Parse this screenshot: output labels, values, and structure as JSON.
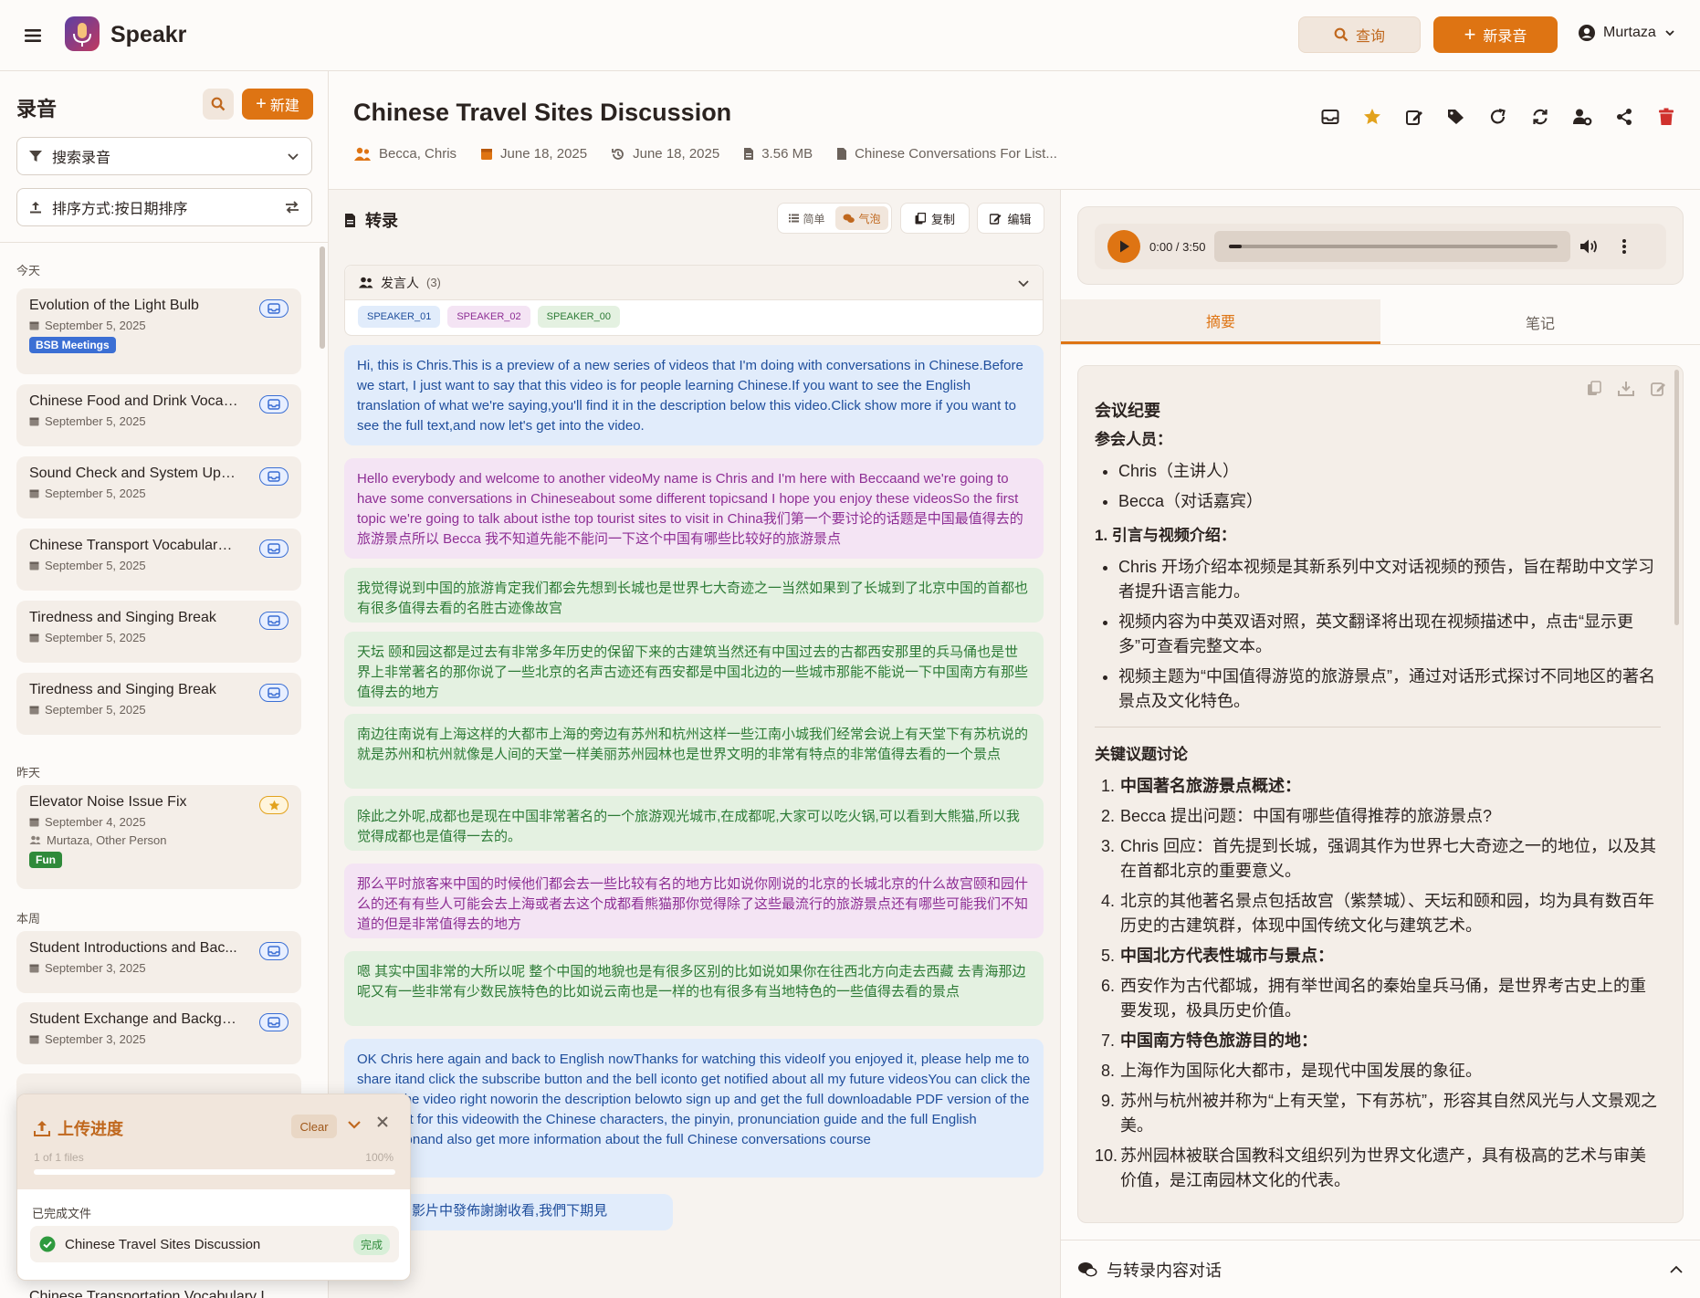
{
  "header": {
    "app_name": "Speakr",
    "query_label": "查询",
    "new_recording_label": "新录音",
    "user_name": "Murtaza"
  },
  "sidebar": {
    "title": "录音",
    "new_label": "新建",
    "search_placeholder": "搜索录音",
    "sort_label": "排序方式:按日期排序",
    "groups": [
      {
        "label": "今天"
      },
      {
        "label": "昨天"
      },
      {
        "label": "本周"
      }
    ],
    "recordings": [
      {
        "title": "Evolution of the Light Bulb",
        "date": "September 5, 2025",
        "tag": "BSB Meetings"
      },
      {
        "title": "Chinese Food and Drink Vocab...",
        "date": "September 5, 2025"
      },
      {
        "title": "Sound Check and System Upd...",
        "date": "September 5, 2025"
      },
      {
        "title": "Chinese Transport Vocabulary ...",
        "date": "September 5, 2025"
      },
      {
        "title": "Tiredness and Singing Break",
        "date": "September 5, 2025"
      },
      {
        "title": "Tiredness and Singing Break",
        "date": "September 5, 2025"
      },
      {
        "title": "Elevator Noise Issue Fix",
        "date": "September 4, 2025",
        "participants": "Murtaza, Other Person",
        "tag": "Fun"
      },
      {
        "title": "Student Introductions and Bac...",
        "date": "September 3, 2025"
      },
      {
        "title": "Student Exchange and Backgro...",
        "date": "September 3, 2025"
      },
      {
        "title": "Chinese Transportation Vocabulary L..."
      }
    ]
  },
  "upload": {
    "title": "上传进度",
    "clear_label": "Clear",
    "count": "1 of 1 files",
    "percent": "100%",
    "progress": 1.0,
    "done_label": "已完成文件",
    "file_name": "Chinese Travel Sites Discussion",
    "file_status": "完成"
  },
  "recording": {
    "title": "Chinese Travel Sites Discussion",
    "participants": "Becca, Chris",
    "date": "June 18, 2025",
    "date2": "June 18, 2025",
    "size": "3.56 MB",
    "folder": "Chinese Conversations For List..."
  },
  "transcript": {
    "title": "转录",
    "view_simple": "简单",
    "view_bubble": "气泡",
    "copy_label": "复制",
    "edit_label": "编辑",
    "speakers_label": "发言人",
    "speakers_count": "(3)",
    "speakers": [
      "SPEAKER_01",
      "SPEAKER_02",
      "SPEAKER_00"
    ],
    "segments": [
      "Hi, this is Chris.This is a preview of a new series of videos that I'm doing with conversations in Chinese.Before we start, I just want to say that this video is for people learning Chinese.If you want to see the English translation of what we're saying,you'll find it in the description below this video.Click show more if you want to see the full text,and now let's get into the video.",
      "Hello everybody and welcome to another videoMy name is Chris and I'm here with Beccaand we're going to have some conversations in Chineseabout some different topicsand I hope you enjoy these videosSo the first topic we're going to talk about isthe top tourist sites to visit in China我们第一个要讨论的话题是中国最值得去的旅游景点所以 Becca 我不知道先能不能问一下这个中国有哪些比较好的旅游景点",
      "我觉得说到中国的旅游肯定我们都会先想到长城也是世界七大奇迹之一当然如果到了长城到了北京中国的首都也有很多值得去看的名胜古迹像故宫",
      "天坛 颐和园这都是过去有非常多年历史的保留下来的古建筑当然还有中国过去的古都西安那里的兵马俑也是世界上非常著名的那你说了一些北京的名声古迹还有西安都是中国北边的一些城市那能不能说一下中国南方有那些值得去的地方",
      "南边往南说有上海这样的大都市上海的旁边有苏州和杭州这样一些江南小城我们经常会说上有天堂下有苏杭说的就是苏州和杭州就像是人间的天堂一样美丽苏州园林也是世界文明的非常有特点的非常值得去看的一个景点",
      "除此之外呢,成都也是现在中国非常著名的一个旅游观光城市,在成都呢,大家可以吃火锅,可以看到大熊猫,所以我觉得成都也是值得一去的。",
      "那么平时旅客来中国的时候他们都会去一些比较有名的地方比如说你刚说的北京的长城北京的什么故宫颐和园什么的还有有些人可能会去上海或者去这个成都看熊猫那你觉得除了这些最流行的旅游景点还有哪些可能我们不知道的但是非常值得去的地方",
      "嗯 其实中国非常的大所以呢 整个中国的地貌也是有很多区别的比如说如果你在往西北方向走去西藏 去青海那边呢又有一些非常有少数民族特色的比如说云南也是一样的也有很多有当地特色的一些值得去看的景点",
      "OK Chris here again and back to English nowThanks for watching this videoIf you enjoyed it, please help me to share itand click the subscribe button and the bell iconto get notified about all my future videosYou can click the link on the video right noworin the description belowto sign up and get the full downloadable PDF version of the transcript for this videowith the Chinese characters, the pinyin, pronunciation guide and the full English translationand also get more information about the full Chinese conversations course",
      "在未來的影片中發佈謝謝收看,我們下期見"
    ]
  },
  "player": {
    "time": "0:00 / 3:50",
    "progress": 0.0
  },
  "tabs": {
    "summary": "摘要",
    "notes": "笔记"
  },
  "summary": {
    "heading": "会议纪要",
    "attendees_label": "参会人员：",
    "attendees": [
      "Chris（主讲人）",
      "Becca（对话嘉宾）"
    ],
    "section1_title": "1. 引言与视频介绍：",
    "section1_items": [
      "Chris 开场介绍本视频是其新系列中文对话视频的预告，旨在帮助中文学习者提升语言能力。",
      "视频内容为中英双语对照，英文翻译将出现在视频描述中，点击“显示更多”可查看完整文本。",
      "视频主题为“中国值得游览的旅游景点”，通过对话形式探讨不同地区的著名景点及文化特色。"
    ],
    "section2_title": "关键议题讨论",
    "section2_items": [
      {
        "n": "1.",
        "text": "中国著名旅游景点概述：",
        "bold": true
      },
      {
        "n": "2.",
        "text": "Becca 提出问题：中国有哪些值得推荐的旅游景点?"
      },
      {
        "n": "3.",
        "text": "Chris 回应：首先提到长城，强调其作为世界七大奇迹之一的地位，以及其在首都北京的重要意义。"
      },
      {
        "n": "4.",
        "text": "北京的其他著名景点包括故宫（紫禁城）、天坛和颐和园，均为具有数百年历史的古建筑群，体现中国传统文化与建筑艺术。"
      },
      {
        "n": "5.",
        "text": "中国北方代表性城市与景点：",
        "bold": true
      },
      {
        "n": "6.",
        "text": "西安作为古代都城，拥有举世闻名的秦始皇兵马俑，是世界考古史上的重要发现，极具历史价值。"
      },
      {
        "n": "7.",
        "text": "中国南方特色旅游目的地：",
        "bold": true
      },
      {
        "n": "8.",
        "text": "上海作为国际化大都市，是现代中国发展的象征。"
      },
      {
        "n": "9.",
        "text": "苏州与杭州被并称为“上有天堂，下有苏杭”，形容其自然风光与人文景观之美。"
      },
      {
        "n": "10.",
        "text": "苏州园林被联合国教科文组织列为世界文化遗产，具有极高的艺术与审美价值，是江南园林文化的代表。"
      }
    ]
  },
  "chat": {
    "label": "与转录内容对话"
  },
  "colors": {
    "accent": "#de7413",
    "speaker_blue": "#1f4e9c",
    "speaker_pink": "#8d2e94",
    "speaker_green": "#2c7a35"
  }
}
